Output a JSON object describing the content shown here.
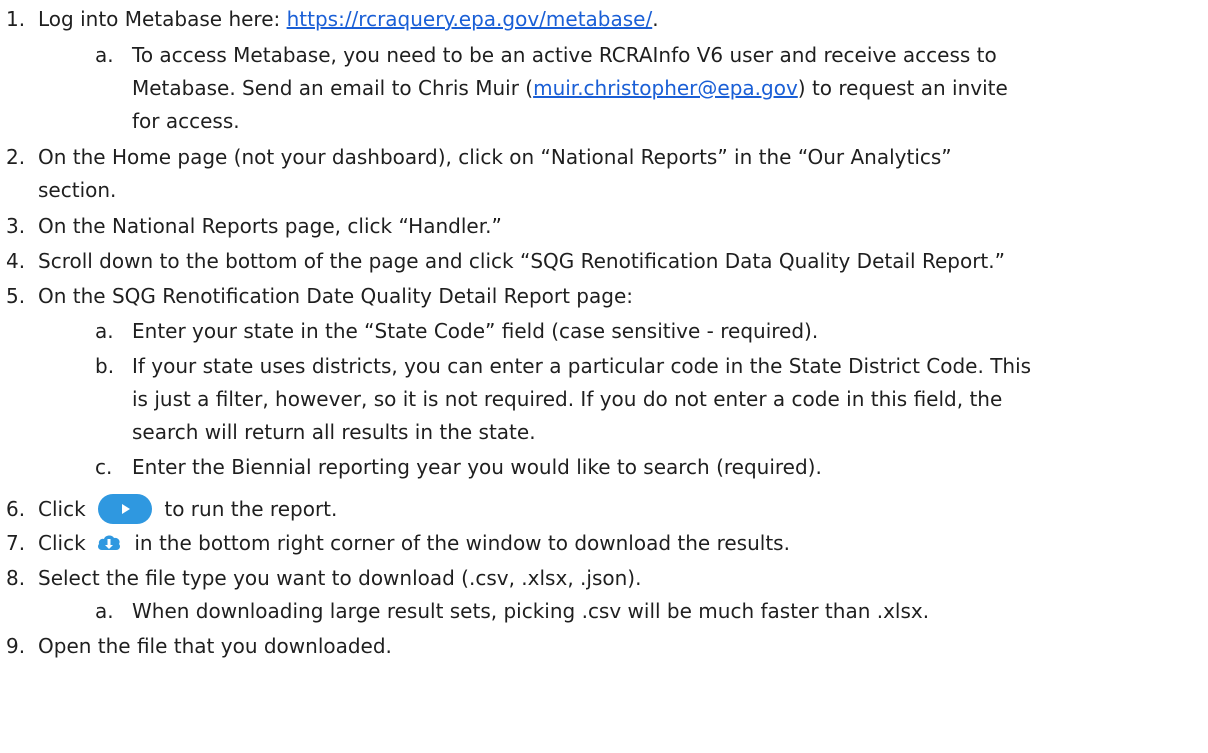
{
  "steps": [
    {
      "num": "1.",
      "pre": "Log into Metabase here: ",
      "link": "https://rcraquery.epa.gov/metabase/",
      "post": ".",
      "sub": [
        {
          "letter": "a.",
          "lines": [
            "To access Metabase, you need to be an active RCRAInfo V6 user and receive access to",
            "Metabase. Send an email to Chris Muir (",
            "for access."
          ],
          "email": "muir.christopher@epa.gov",
          "email_post": ") to request an invite"
        }
      ]
    },
    {
      "num": "2.",
      "lines": [
        "On the Home page (not your dashboard), click on “National Reports” in the “Our Analytics”",
        "section."
      ]
    },
    {
      "num": "3.",
      "lines": [
        "On the National Reports page, click “Handler.”"
      ]
    },
    {
      "num": "4.",
      "lines": [
        "Scroll down to the bottom of the page and click “SQG Renotification Data Quality Detail Report.”"
      ]
    },
    {
      "num": "5.",
      "lines": [
        "On the SQG Renotification Date Quality Detail Report page:"
      ],
      "sub": [
        {
          "letter": "a.",
          "lines": [
            "Enter your state in the “State Code” field (case sensitive - required)."
          ]
        },
        {
          "letter": "b.",
          "lines": [
            "If your state uses districts, you can enter a particular code in the State District Code. This",
            "is just a filter, however, so it is not required. If you do not enter a code in this field, the",
            "search will return all results in the state."
          ]
        },
        {
          "letter": "c.",
          "lines": [
            "Enter the Biennial reporting year you would like to search (required)."
          ]
        }
      ]
    },
    {
      "num": "6.",
      "pre": "Click",
      "icon": "play-button-icon",
      "post": "to run the report."
    },
    {
      "num": "7.",
      "pre": "Click",
      "icon": "cloud-download-icon",
      "post": "in the bottom right corner of the window to download the results."
    },
    {
      "num": "8.",
      "lines": [
        "Select the file type you want to download (.csv, .xlsx, .json)."
      ],
      "sub": [
        {
          "letter": "a.",
          "lines": [
            "When downloading large result sets, picking .csv will be much faster than .xlsx."
          ]
        }
      ]
    },
    {
      "num": "9.",
      "lines": [
        "Open the file that you downloaded."
      ]
    }
  ],
  "colors": {
    "text": "#1f1f1f",
    "link": "#1a5fd6",
    "run_button": "#2f98e0",
    "download_icon": "#2f98e0"
  }
}
